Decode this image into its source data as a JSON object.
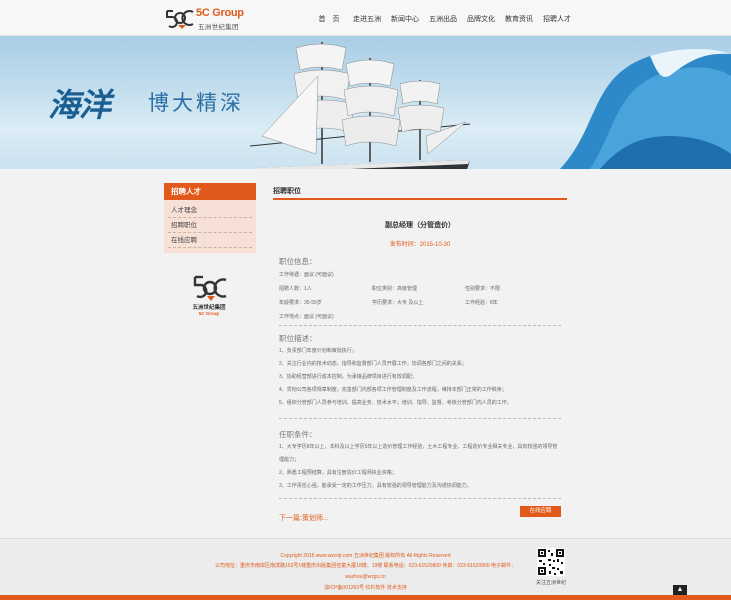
{
  "brand": {
    "name_en": "5C Group",
    "name_cn": "五洲世纪集团"
  },
  "nav": {
    "items": [
      {
        "label": "首　页"
      },
      {
        "label": "走进五洲"
      },
      {
        "label": "新闻中心"
      },
      {
        "label": "五洲出品"
      },
      {
        "label": "品牌文化"
      },
      {
        "label": "教育资讯"
      },
      {
        "label": "招聘人才"
      }
    ]
  },
  "banner": {
    "slogan_1": "海洋",
    "slogan_2": "博大精深"
  },
  "sidebar": {
    "title": "招聘人才",
    "items": [
      {
        "label": "人才理念"
      },
      {
        "label": "招聘职位"
      },
      {
        "label": "在线应聘"
      }
    ],
    "logo_cn": "五洲世纪集团",
    "logo_en": "5C Group"
  },
  "content": {
    "breadcrumb": "招聘职位",
    "job_title": "副总经理（分管造价）",
    "publish_date": "发布时间：2015-10-30",
    "info_heading": "职位信息：",
    "salary": "工作待遇：面议 (可面议)",
    "headcount": "招聘人数：1人",
    "category": "职位类别：高级管理",
    "gender": "性别要求：不限",
    "age": "年龄要求：35-55岁",
    "education": "学历要求：大专 及以上",
    "experience": "工作经验：8年",
    "location": "工作地点：面议 (可面议)",
    "desc_heading": "职位描述：",
    "desc_items": [
      "1、负责部门年度计划和审批执行；",
      "2、关注行业内的技术动态，指导和监督部门人员开展工作，协调各部门之间的关系；",
      "3、协助经营部进行成本控制，为承接品牌项目进行有效调配；",
      "4、贯彻公司各项规章制度，完善部门内部各项工作管理制度及工作流程，维持本部门正常的工作秩序；",
      "5、组织分管部门人员参与培训、提高业务、技术水平；培训、指导、监督、考核分管部门内人员的工作。"
    ],
    "req_heading": "任职条件：",
    "req_items": [
      "1、大专学历8年以上、本科及以上学历5年以上造价管理工作经验，土木工程专业、工程造价专业相关专业，具有较强的领导管理能力；",
      "2、熟悉工程预结算，具有注册造价工程师执业资格；",
      "3、工作责任心强，能承受一定的工作压力，具有较强的领导管理能力及沟通协调能力。"
    ],
    "next_label": "下一篇:策划师...",
    "apply_button": "在线应聘"
  },
  "footer": {
    "copyright": "Copyright 2015 www.wzcnjt.com 五洲世纪集团 版权所有 All Rights Reserved",
    "address": "公司地址：重庆市南岸区南滨路162号1幢重庆出版集团佳童大厦18楼、19楼 联系电话：023-61520800 传真：023-61520900 电子邮件：",
    "email": "wuzhou@wzgs.cn",
    "icp": "渝ICP备001263号  红杉软件 技术支持",
    "qr_caption": "关注五洲世纪"
  },
  "to_top": "▲",
  "colors": {
    "accent": "#e15a1b",
    "sidebar_bg": "#f7e0d6",
    "banner_text": "#1a5f92"
  },
  "icons": {
    "logo": "5c-logo-mark",
    "back_to_top": "chevron-up-icon"
  }
}
